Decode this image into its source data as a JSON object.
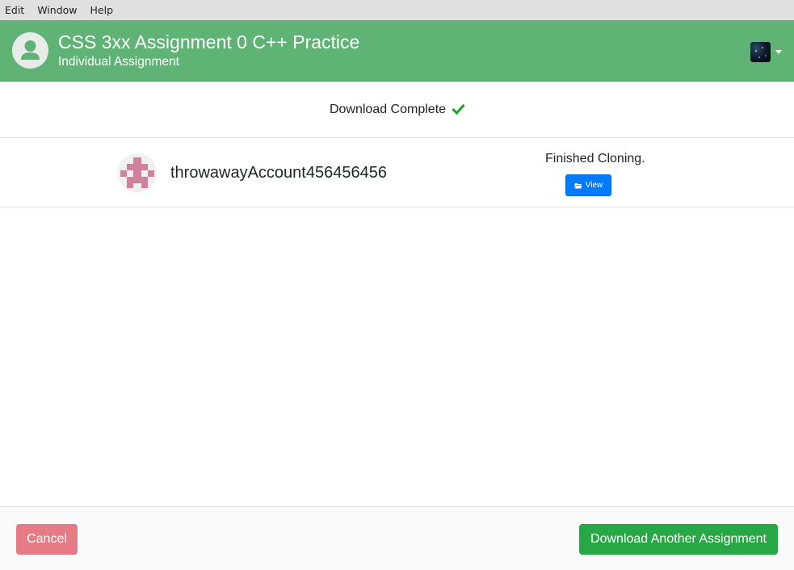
{
  "menu": {
    "items": [
      {
        "label": "Edit"
      },
      {
        "label": "Window"
      },
      {
        "label": "Help"
      }
    ]
  },
  "header": {
    "title": "CSS 3xx Assignment 0 C++ Practice",
    "subtitle": "Individual Assignment",
    "background_color": "#5fb375"
  },
  "status": {
    "text": "Download Complete",
    "icon": "check-icon",
    "icon_color": "#1e9e2e"
  },
  "result": {
    "username": "throwawayAccount456456456",
    "clone_status": "Finished Cloning.",
    "view_label": "View",
    "view_icon": "folder-open-icon"
  },
  "footer": {
    "cancel_label": "Cancel",
    "download_another_label": "Download Another Assignment",
    "cancel_color": "#e57c85",
    "download_color": "#28a745"
  }
}
